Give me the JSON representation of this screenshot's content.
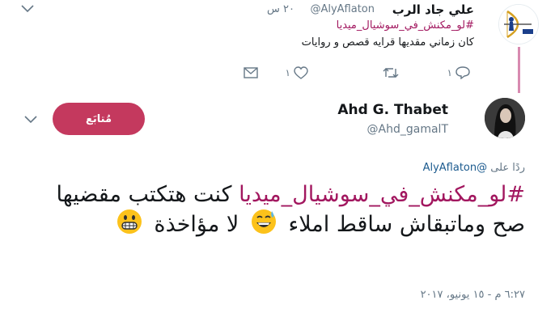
{
  "parent_tweet": {
    "author_name": "علي جاد الرب",
    "handle": "@AlyAflaton",
    "time": "٢٠ س",
    "hashtag": "#لو_مكنش_في_سوشيال_ميديا",
    "text": "كان زماني مقديها قرايه قصص و روايات",
    "reply_count": "١",
    "like_count": "١",
    "icons": [
      "chevron-down-icon",
      "reply-icon",
      "retweet-icon",
      "heart-icon",
      "mail-icon"
    ]
  },
  "main_tweet": {
    "author_name": "Ahd G. Thabet",
    "handle": "@Ahd_gamalT",
    "follow_label": "مُتابَع",
    "replying_prefix": "ردًا على",
    "replying_to": "@AlyAflaton",
    "hashtag": "#لو_مكنش_في_سوشيال_ميديا",
    "text_1": " كنت هتكتب مقضيها صح وماتبقاش ساقط املاء ",
    "text_2": " لا مؤاخذة ",
    "timestamp": "٦:٢٧ م - ١٥ يونيو، ٢٠١٧",
    "icons": [
      "chevron-down-icon",
      "sweat-smile-emoji",
      "grimacing-emoji"
    ]
  },
  "colors": {
    "hashtag": "#a2175f",
    "follow_button": "#c4395e",
    "link": "#1b5a8e",
    "muted": "#657786"
  }
}
